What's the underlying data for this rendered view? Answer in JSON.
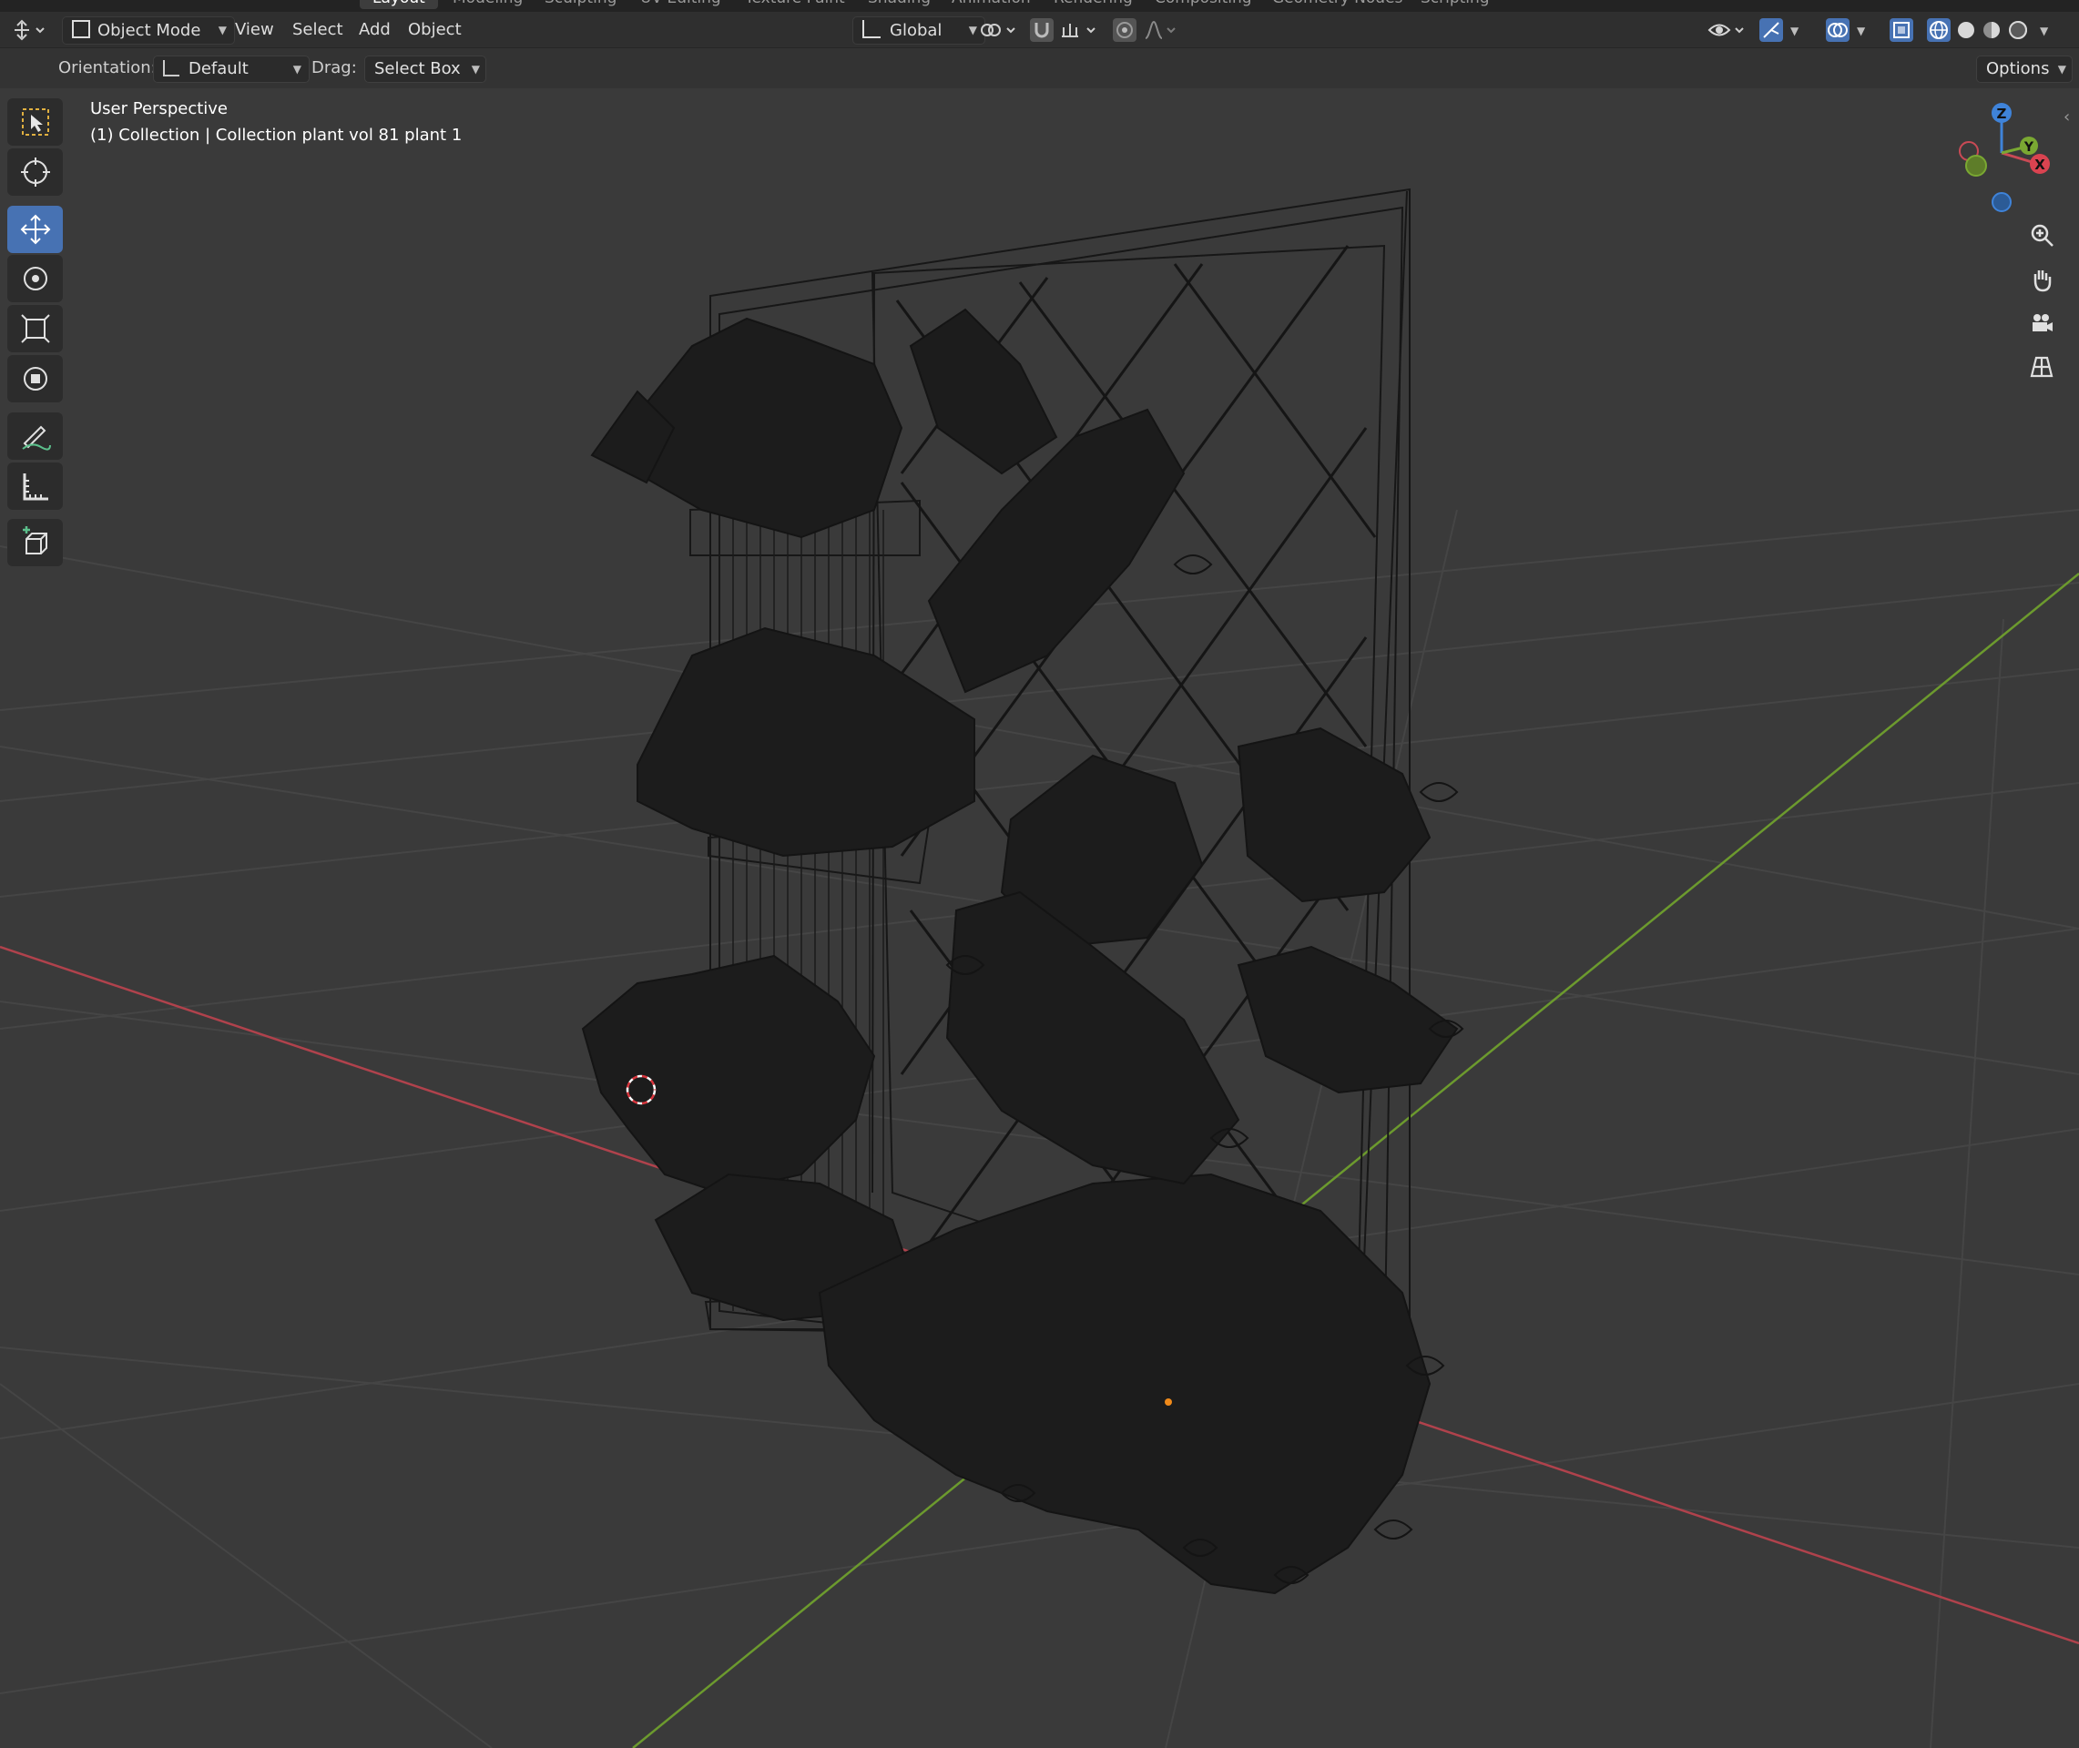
{
  "workspace_tabs": [
    "Layout",
    "Modeling",
    "Sculpting",
    "UV Editing",
    "Texture Paint",
    "Shading",
    "Animation",
    "Rendering",
    "Compositing",
    "Geometry Nodes",
    "Scripting"
  ],
  "header": {
    "mode": "Object Mode",
    "menus": [
      "View",
      "Select",
      "Add",
      "Object"
    ],
    "transform_orientation": "Global"
  },
  "tool_settings": {
    "orientation_label": "Orientation:",
    "orientation_value": "Default",
    "drag_label": "Drag:",
    "drag_value": "Select Box",
    "options_label": "Options"
  },
  "viewport": {
    "perspective_label": "User Perspective",
    "collection_label": "(1) Collection | Collection plant vol 81 plant 1"
  },
  "gizmo": {
    "x_label": "X",
    "y_label": "Y",
    "z_label": "Z"
  },
  "colors": {
    "accent": "#4772b3",
    "axis_x": "#c94a55",
    "axis_y": "#7aa832",
    "axis_z": "#3f83d9",
    "viewport_bg": "#3a3a3a"
  }
}
